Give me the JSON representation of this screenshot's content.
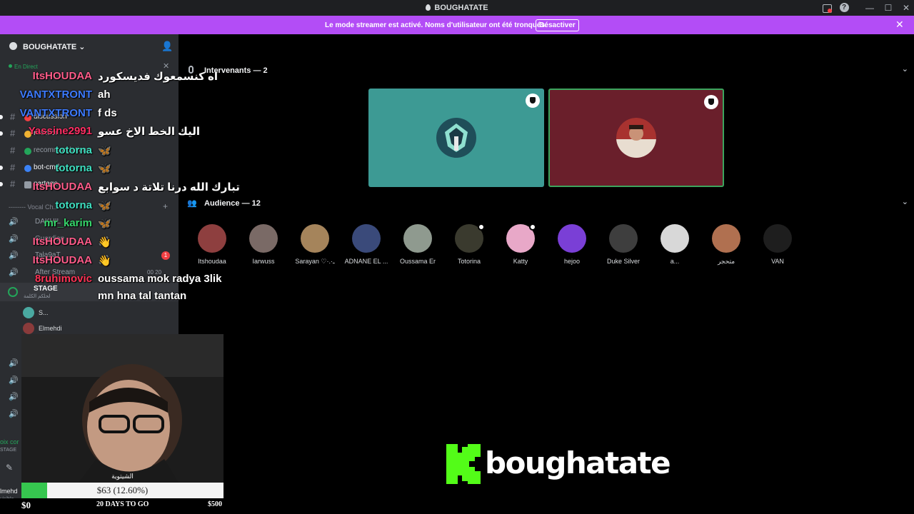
{
  "window": {
    "title": "BOUGHATATE"
  },
  "banner": {
    "message": "Le mode streamer est activé. Noms d'utilisateur ont été tronqués.",
    "button": "Désactiver"
  },
  "sidebar": {
    "server_name": "BOUGHATATE",
    "live_label": "En Direct",
    "channels": [
      {
        "label": "discussion",
        "color": "#f23f43"
      },
      {
        "label": "reaction",
        "color": "#f0b232"
      },
      {
        "label": "recommandations",
        "color": "#23a55a"
      },
      {
        "label": "bot-cmd",
        "color": "#3b82f6"
      },
      {
        "label": "partage",
        "color": "#949ba4"
      }
    ],
    "voice_separator": "-------- Vocal Ch...",
    "voice_channels": [
      {
        "label": "DAKHIL"
      },
      {
        "label": "Guardian"
      },
      {
        "label": "Tala9aT"
      },
      {
        "label": "After Stream"
      }
    ],
    "voice_counts": "00  20",
    "unread_badge": "1",
    "stage": {
      "label": "STAGE",
      "sub": "لحلكم الكلمة"
    },
    "stage_members": [
      {
        "name": "S...",
        "color": "#4aa9a1"
      },
      {
        "name": "Elmehdi",
        "color": "#8a3b3b"
      }
    ],
    "left_edge_text": [
      "oix cor",
      "STAGE",
      "lmehd",
      "visible"
    ]
  },
  "chat": [
    {
      "user": "ItsHOUDAA",
      "color": "#ff5c8a",
      "text": "اه كنسمعوك فديسكورد"
    },
    {
      "user": "VANTXTRONT",
      "color": "#3d7bff",
      "text": "ah"
    },
    {
      "user": "VANTXTRONT",
      "color": "#3d7bff",
      "text": "f ds"
    },
    {
      "user": "Yassine2991",
      "color": "#ff2e63",
      "text": "اليك الخط الاخ عسو"
    },
    {
      "user": "totorna",
      "color": "#3fe0c1",
      "text": "🦋"
    },
    {
      "user": "totorna",
      "color": "#3fe0c1",
      "text": "🦋"
    },
    {
      "user": "ItsHOUDAA",
      "color": "#ff5c8a",
      "text": "تبارك الله درنا تلاتة د سوابع"
    },
    {
      "user": "totorna",
      "color": "#3fe0c1",
      "text": "🦋"
    },
    {
      "user": "mr_karim",
      "color": "#36d66b",
      "text": "🦋"
    },
    {
      "user": "ItsHOUDAA",
      "color": "#ff5c8a",
      "text": "👋"
    },
    {
      "user": "ItsHOUDAA",
      "color": "#ff5c8a",
      "text": "👋"
    },
    {
      "user": "8ruhimovic",
      "color": "#ff3355",
      "text": "oussama mok radya 3lik"
    },
    {
      "user": "",
      "color": "#ffffff",
      "text": "mn hna tal tantan"
    }
  ],
  "speakers": {
    "label": "Intervenants — 2",
    "tiles": [
      {
        "bg": "#3d9a94",
        "avatar": "#2e6e78"
      },
      {
        "bg": "#6a1f2b",
        "avatar": "#d9b59b"
      }
    ]
  },
  "audience": {
    "label": "Audience — 12",
    "members": [
      {
        "name": "Itshoudaa",
        "color": "#8e3f3f",
        "badge": false
      },
      {
        "name": "Iarwuss",
        "color": "#7a6a66",
        "badge": false
      },
      {
        "name": "Sarayan ♡·.·ـ",
        "color": "#a5845b",
        "badge": false
      },
      {
        "name": "ADNANE EL ...",
        "color": "#3a4a7a",
        "badge": false
      },
      {
        "name": "Oussama Er",
        "color": "#8f9a8f",
        "badge": false
      },
      {
        "name": "Totorina",
        "color": "#3a3a2e",
        "badge": true
      },
      {
        "name": "Katty",
        "color": "#e8a8c8",
        "badge": true
      },
      {
        "name": "hejoo",
        "color": "#7a3fd6",
        "badge": false
      },
      {
        "name": "Duke Silver",
        "color": "#3e3e3e",
        "badge": false
      },
      {
        "name": "a...",
        "color": "#d8d8d8",
        "badge": false
      },
      {
        "name": "متحجر",
        "color": "#b07050",
        "badge": false
      },
      {
        "name": "VAN",
        "color": "#1e1e1e",
        "badge": false
      }
    ]
  },
  "webcam": {
    "label": "الشيتوية"
  },
  "goal": {
    "amount": "$63 (12.60%)",
    "progress": 0.126,
    "min": "$0",
    "max": "$500",
    "days": "20 DAYS TO GO"
  },
  "brand": {
    "name": "boughatate",
    "color": "#53fc18"
  }
}
